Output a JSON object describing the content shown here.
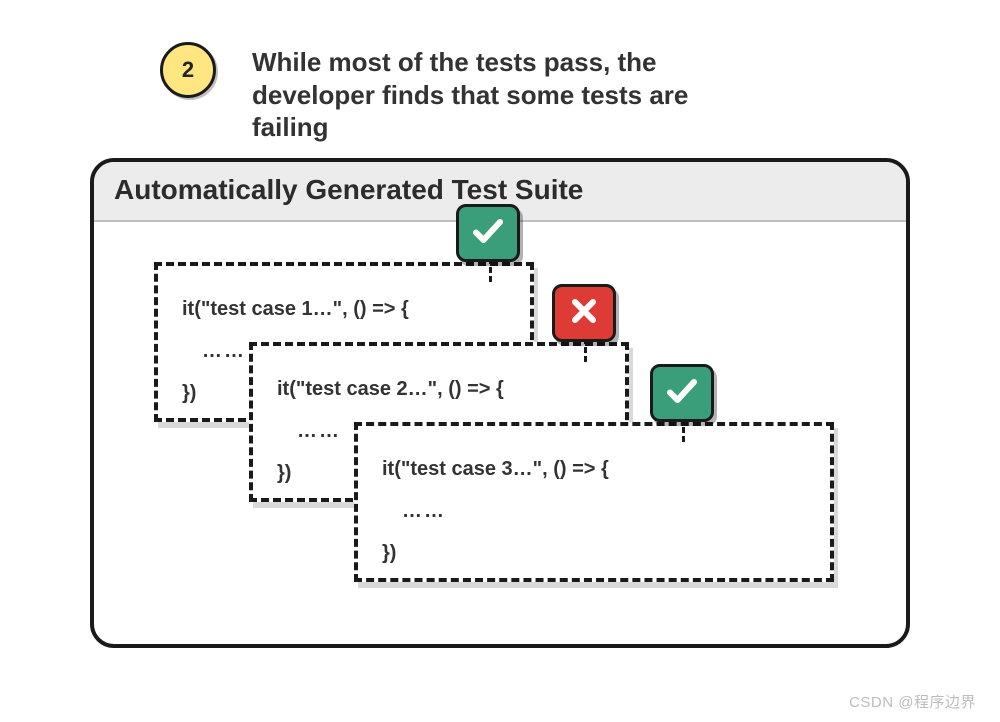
{
  "step": {
    "number": "2",
    "text": "While most of the tests pass, the developer finds that some tests are failing"
  },
  "panel": {
    "title": "Automatically Generated Test Suite"
  },
  "cases": [
    {
      "code_open": "it(\"test case 1…\", () => {",
      "code_body": "……",
      "code_close": "})",
      "status": "pass"
    },
    {
      "code_open": "it(\"test case 2…\", () => {",
      "code_body": "……",
      "code_close": "})",
      "status": "fail"
    },
    {
      "code_open": "it(\"test case 3…\", () => {",
      "code_body": "……",
      "code_close": "})",
      "status": "pass"
    }
  ],
  "watermark": "CSDN @程序边界"
}
